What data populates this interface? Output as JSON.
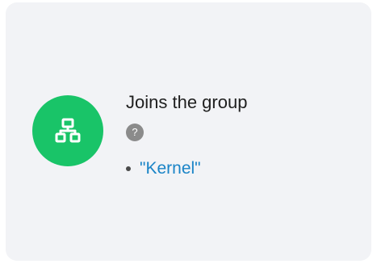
{
  "card": {
    "icon": "sitemap-icon",
    "accent_color": "#19c468",
    "title": "Joins the group",
    "help_symbol": "?",
    "groups": [
      {
        "label": "\"Kernel\""
      }
    ],
    "link_color": "#1a84c7"
  }
}
